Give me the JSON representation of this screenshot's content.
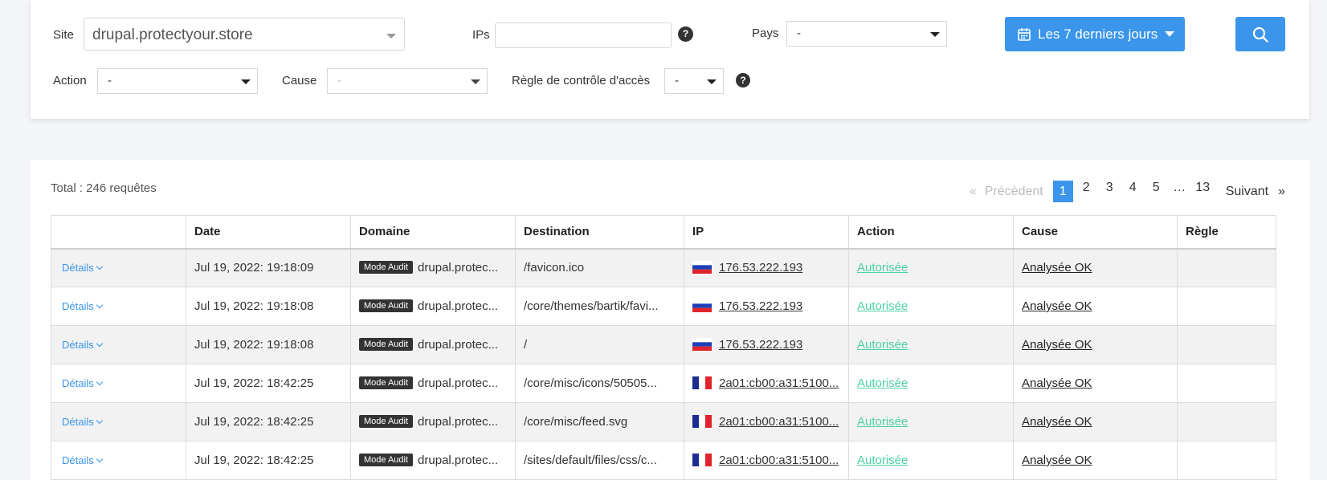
{
  "filters": {
    "site_label": "Site",
    "site_value": "drupal.protectyour.store",
    "ips_label": "IPs",
    "ips_value": "",
    "ips_help": "?",
    "pays_label": "Pays",
    "pays_value": "-",
    "action_label": "Action",
    "action_value": "-",
    "cause_label": "Cause",
    "cause_value": "-",
    "regle_label": "Règle de contrôle d'accès",
    "regle_value": "-",
    "regle_help": "?",
    "date_range_label": "Les 7 derniers jours",
    "accent_color": "#3a95eb"
  },
  "summary": {
    "total": "Total : 246 requêtes"
  },
  "pagination": {
    "prev_arrow": "«",
    "prev_label": "Précèdent",
    "pages": [
      "1",
      "2",
      "3",
      "4",
      "5",
      "…",
      "13"
    ],
    "current": "1",
    "next_label": "Suivant",
    "next_arrow": "»"
  },
  "table": {
    "columns": [
      "",
      "Date",
      "Domaine",
      "Destination",
      "IP",
      "Action",
      "Cause",
      "Règle"
    ],
    "rows": [
      {
        "details": "Détails",
        "date": "Jul 19, 2022: 19:18:09",
        "badge": "Mode Audit",
        "domain": "drupal.protec...",
        "destination": "/favicon.ico",
        "flag": "ru-flag-icon",
        "ip": "176.53.222.193",
        "action": "Autorisée",
        "cause": "Analysée OK",
        "rule": ""
      },
      {
        "details": "Détails",
        "date": "Jul 19, 2022: 19:18:08",
        "badge": "Mode Audit",
        "domain": "drupal.protec...",
        "destination": "/core/themes/bartik/favi...",
        "flag": "ru-flag-icon",
        "ip": "176.53.222.193",
        "action": "Autorisée",
        "cause": "Analysée OK",
        "rule": ""
      },
      {
        "details": "Détails",
        "date": "Jul 19, 2022: 19:18:08",
        "badge": "Mode Audit",
        "domain": "drupal.protec...",
        "destination": "/",
        "flag": "ru-flag-icon",
        "ip": "176.53.222.193",
        "action": "Autorisée",
        "cause": "Analysée OK",
        "rule": ""
      },
      {
        "details": "Détails",
        "date": "Jul 19, 2022: 18:42:25",
        "badge": "Mode Audit",
        "domain": "drupal.protec...",
        "destination": "/core/misc/icons/50505...",
        "flag": "fr-flag-icon",
        "ip": "2a01:cb00:a31:5100...",
        "action": "Autorisée",
        "cause": "Analysée OK",
        "rule": ""
      },
      {
        "details": "Détails",
        "date": "Jul 19, 2022: 18:42:25",
        "badge": "Mode Audit",
        "domain": "drupal.protec...",
        "destination": "/core/misc/feed.svg",
        "flag": "fr-flag-icon",
        "ip": "2a01:cb00:a31:5100...",
        "action": "Autorisée",
        "cause": "Analysée OK",
        "rule": ""
      },
      {
        "details": "Détails",
        "date": "Jul 19, 2022: 18:42:25",
        "badge": "Mode Audit",
        "domain": "drupal.protec...",
        "destination": "/sites/default/files/css/c...",
        "flag": "fr-flag-icon",
        "ip": "2a01:cb00:a31:5100...",
        "action": "Autorisée",
        "cause": "Analysée OK",
        "rule": ""
      }
    ]
  }
}
